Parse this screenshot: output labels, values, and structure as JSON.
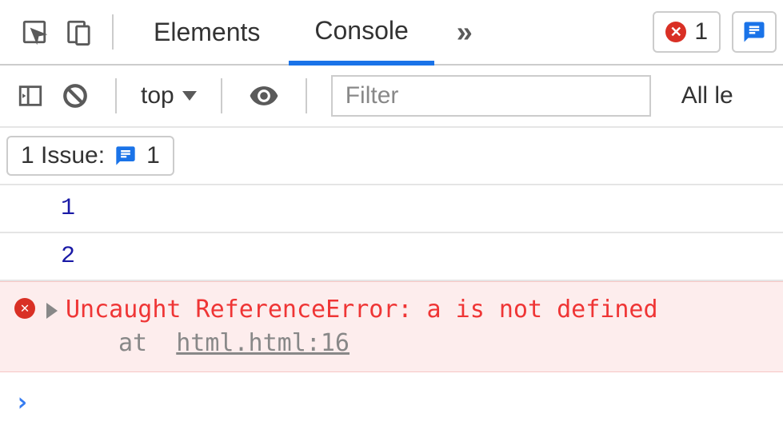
{
  "tabs": {
    "elements": "Elements",
    "console": "Console",
    "more": "»"
  },
  "errorBadge": {
    "count": "1"
  },
  "toolbar": {
    "context": "top",
    "filterPlaceholder": "Filter",
    "levelLabel": "All le"
  },
  "issues": {
    "label": "1 Issue:",
    "count": "1"
  },
  "logs": {
    "line1": "1",
    "line2": "2"
  },
  "error": {
    "message": "Uncaught ReferenceError: a is not defined",
    "stackPrefix": "at",
    "stackLocation": "html.html:16"
  },
  "prompt": "›"
}
